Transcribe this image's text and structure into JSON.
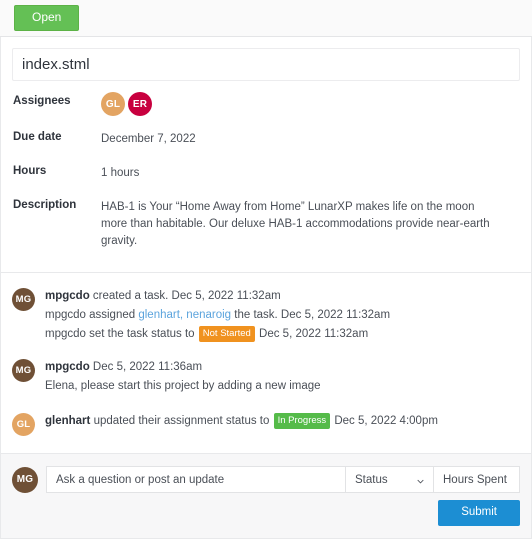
{
  "toolbar": {
    "open_label": "Open"
  },
  "task": {
    "title": "index.stml",
    "fields": [
      {
        "label": "Assignees",
        "type": "avatars"
      },
      {
        "label": "Due date",
        "value": "December 7, 2022"
      },
      {
        "label": "Hours",
        "value": "1 hours"
      },
      {
        "label": "Description",
        "value": "HAB-1 is Your “Home Away from Home” LunarXP makes life on the moon more than habitable. Our deluxe HAB-1 accommodations provide near-earth gravity."
      }
    ],
    "assignees": [
      {
        "initials": "GL",
        "color": "#e3a462"
      },
      {
        "initials": "ER",
        "color": "#c8003f"
      }
    ]
  },
  "activity": [
    {
      "avatar": {
        "initials": "MG",
        "color": "#6f5036"
      },
      "lines": [
        {
          "author": "mpgcdo",
          "text": " created a task. Dec 5, 2022 11:32am"
        },
        {
          "pre": "mpgcdo assigned ",
          "links": "glenhart, nenaroig",
          "post": " the task. Dec 5, 2022 11:32am"
        },
        {
          "pre": "mpgcdo set the task status to ",
          "badge": "Not Started",
          "badge_color": "orange",
          "post": " Dec 5, 2022 11:32am"
        }
      ]
    },
    {
      "avatar": {
        "initials": "MG",
        "color": "#6f5036"
      },
      "lines": [
        {
          "author": "mpgcdo",
          "text": " Dec 5, 2022 11:36am"
        },
        {
          "pre": "Elena, please start this project by adding a new image"
        }
      ]
    },
    {
      "avatar": {
        "initials": "GL",
        "color": "#e3a462"
      },
      "lines": [
        {
          "author": "glenhart",
          "text": " updated their assignment status to ",
          "badge": "In Progress",
          "badge_color": "green",
          "post": " Dec 5, 2022 4:00pm"
        }
      ]
    }
  ],
  "composer": {
    "avatar": {
      "initials": "MG",
      "color": "#6f5036"
    },
    "comment_placeholder": "Ask a question or post an update",
    "comment_value": "",
    "status_label": "Status",
    "hours_placeholder": "Hours Spent",
    "hours_value": "",
    "submit_label": "Submit"
  },
  "colors": {
    "open_green": "#64c055",
    "submit_blue": "#1c8ed3",
    "badge_orange": "#f0921f",
    "badge_green": "#55bb49",
    "link_blue": "#5ca4dd"
  }
}
